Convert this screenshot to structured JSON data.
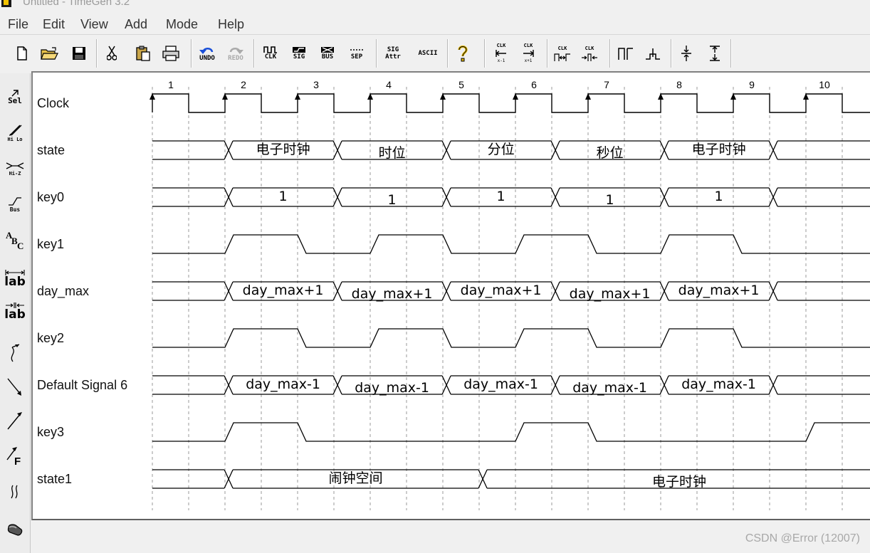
{
  "window": {
    "title": "Untitled - TimeGen 3.2"
  },
  "menu": [
    "File",
    "Edit",
    "View",
    "Add",
    "Mode",
    "Help"
  ],
  "toolbar": {
    "new_icon": "new-file-icon",
    "open_icon": "open-folder-icon",
    "save_icon": "save-disk-icon",
    "cut_icon": "scissors-icon",
    "paste_icon": "clipboard-icon",
    "print_icon": "printer-icon",
    "undo_label": "UNDO",
    "redo_label": "REDO",
    "clk_label": "CLK",
    "sig_label": "SIG",
    "bus_label": "BUS",
    "sep_label": "SEP",
    "sig_attr_label": "SIG\nAttr",
    "ascii_label": "ASCII",
    "help_icon": "question-mark-icon",
    "clk_left_label": "CLK",
    "clk_left_sub": "x-1",
    "clk_right_label": "CLK",
    "clk_right_sub": "x+1",
    "clk_expand_label": "CLK",
    "clk_shrink_label": "CLK"
  },
  "left_tools": {
    "sel_label": "Sel",
    "hilo_label": "Hi Lo",
    "hiz_label": "Hi-Z",
    "bus_label": "Bus",
    "text_label": "ABC",
    "lab1_label": "lab",
    "lab2_label": "lab",
    "edge_f_label": "F"
  },
  "timing": {
    "clock_numbers": [
      "1",
      "2",
      "3",
      "4",
      "5",
      "6",
      "7",
      "8",
      "9",
      "10"
    ],
    "signals": [
      {
        "name": "Clock",
        "type": "clock"
      },
      {
        "name": "state",
        "type": "bus",
        "segments": [
          [
            "",
            "n"
          ],
          [
            "电子时钟",
            "b"
          ],
          [
            "时位",
            "b"
          ],
          [
            "分位",
            "b"
          ],
          [
            "秒位",
            "b"
          ],
          [
            "电子时钟",
            "b"
          ],
          [
            "",
            "n"
          ]
        ]
      },
      {
        "name": "key0",
        "type": "bus",
        "segments": [
          [
            "",
            "n"
          ],
          [
            "1",
            "b"
          ],
          [
            "1",
            "b"
          ],
          [
            "1",
            "b"
          ],
          [
            "1",
            "b"
          ],
          [
            "1",
            "b"
          ],
          [
            "",
            "n"
          ]
        ]
      },
      {
        "name": "key1",
        "type": "bit",
        "levels": [
          0,
          1,
          0,
          1,
          0,
          1,
          0,
          1,
          0,
          0
        ]
      },
      {
        "name": "day_max",
        "type": "bus",
        "segments": [
          [
            "",
            "n"
          ],
          [
            "day_max+1",
            "b"
          ],
          [
            "day_max+1",
            "b"
          ],
          [
            "day_max+1",
            "b"
          ],
          [
            "day_max+1",
            "b"
          ],
          [
            "day_max+1",
            "b"
          ],
          [
            "",
            "n"
          ]
        ]
      },
      {
        "name": "key2",
        "type": "bit",
        "levels": [
          0,
          1,
          0,
          1,
          0,
          1,
          0,
          1,
          0,
          0
        ]
      },
      {
        "name": "Default Signal 6",
        "type": "bus",
        "segments": [
          [
            "",
            "n"
          ],
          [
            "day_max-1",
            "b"
          ],
          [
            "day_max-1",
            "b"
          ],
          [
            "day_max-1",
            "b"
          ],
          [
            "day_max-1",
            "b"
          ],
          [
            "day_max-1",
            "b"
          ],
          [
            "",
            "n"
          ]
        ]
      },
      {
        "name": "key3",
        "type": "bit",
        "levels": [
          0,
          1,
          0,
          0,
          0,
          1,
          0,
          0,
          0,
          1
        ]
      },
      {
        "name": "state1",
        "type": "bus",
        "segments": [
          [
            "",
            "n"
          ],
          [
            "闹钟空间",
            "b"
          ],
          [
            "电子时钟",
            "b"
          ]
        ]
      }
    ]
  },
  "watermark": "CSDN @Error (12007)"
}
